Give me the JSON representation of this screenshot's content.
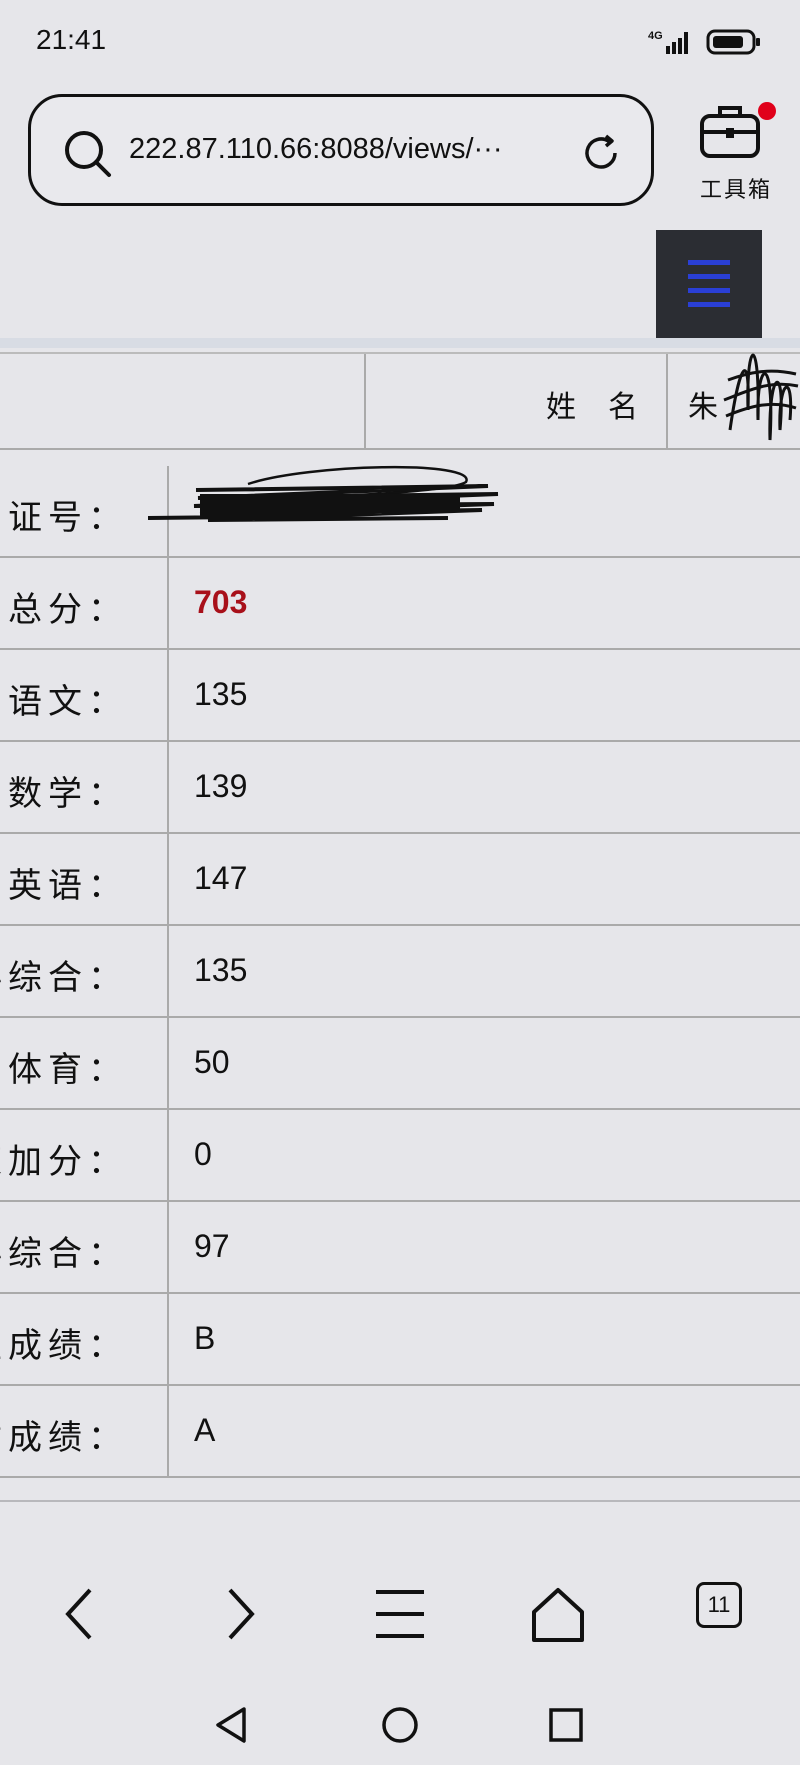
{
  "status_bar": {
    "time": "21:41",
    "network": "4G",
    "icons": [
      "signal-icon",
      "battery-icon"
    ]
  },
  "browser": {
    "url": "222.87.110.66:8088/views/···",
    "toolbox_label": "工具箱",
    "icons": [
      "search-icon",
      "reload-icon",
      "toolbox-icon",
      "menu-icon"
    ]
  },
  "result": {
    "name_label": "姓名",
    "name_value": "朱",
    "rows": [
      {
        "label": "考证号：",
        "value": ""
      },
      {
        "label": "总分：",
        "value": "703"
      },
      {
        "label": "语文：",
        "value": "135"
      },
      {
        "label": "数学：",
        "value": "139"
      },
      {
        "label": "英语：",
        "value": "147"
      },
      {
        "label": "科综合：",
        "value": "135"
      },
      {
        "label": "体育：",
        "value": "50"
      },
      {
        "label": "策加分：",
        "value": "0"
      },
      {
        "label": "科综合：",
        "value": "97"
      },
      {
        "label": "生成绩：",
        "value": "B"
      },
      {
        "label": "质成绩：",
        "value": "A"
      }
    ]
  },
  "bottom_nav": {
    "tab_count": "11",
    "icons": [
      "back-icon",
      "forward-icon",
      "menu-lines-icon",
      "home-icon",
      "tabs-icon"
    ]
  },
  "system_nav": {
    "icons": [
      "sys-back-icon",
      "sys-home-icon",
      "sys-recents-icon"
    ]
  },
  "colors": {
    "total_score": "#a8101a",
    "notify_dot": "#e0001a",
    "menu_lines": "#2a3fd6"
  }
}
